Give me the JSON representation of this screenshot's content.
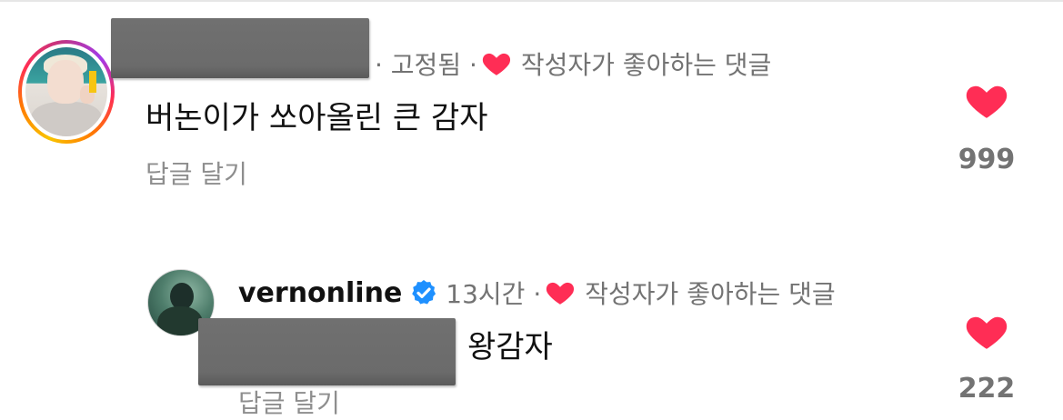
{
  "comments": [
    {
      "meta_pinned": "· 고정됨 ·",
      "creator_liked": "작성자가 좋아하는 댓글",
      "text": "버논이가 쏘아올린 큰 감자",
      "reply_label": "답글 달기",
      "like_count": "999"
    },
    {
      "username": "vernonline",
      "time": "13시간 ·",
      "creator_liked": "작성자가 좋아하는 댓글",
      "text": "왕감자",
      "reply_label": "답글 달기",
      "like_count": "222"
    }
  ],
  "colors": {
    "heart": "#ff2d55",
    "verified": "#1e90ff",
    "meta_text": "#737373"
  }
}
